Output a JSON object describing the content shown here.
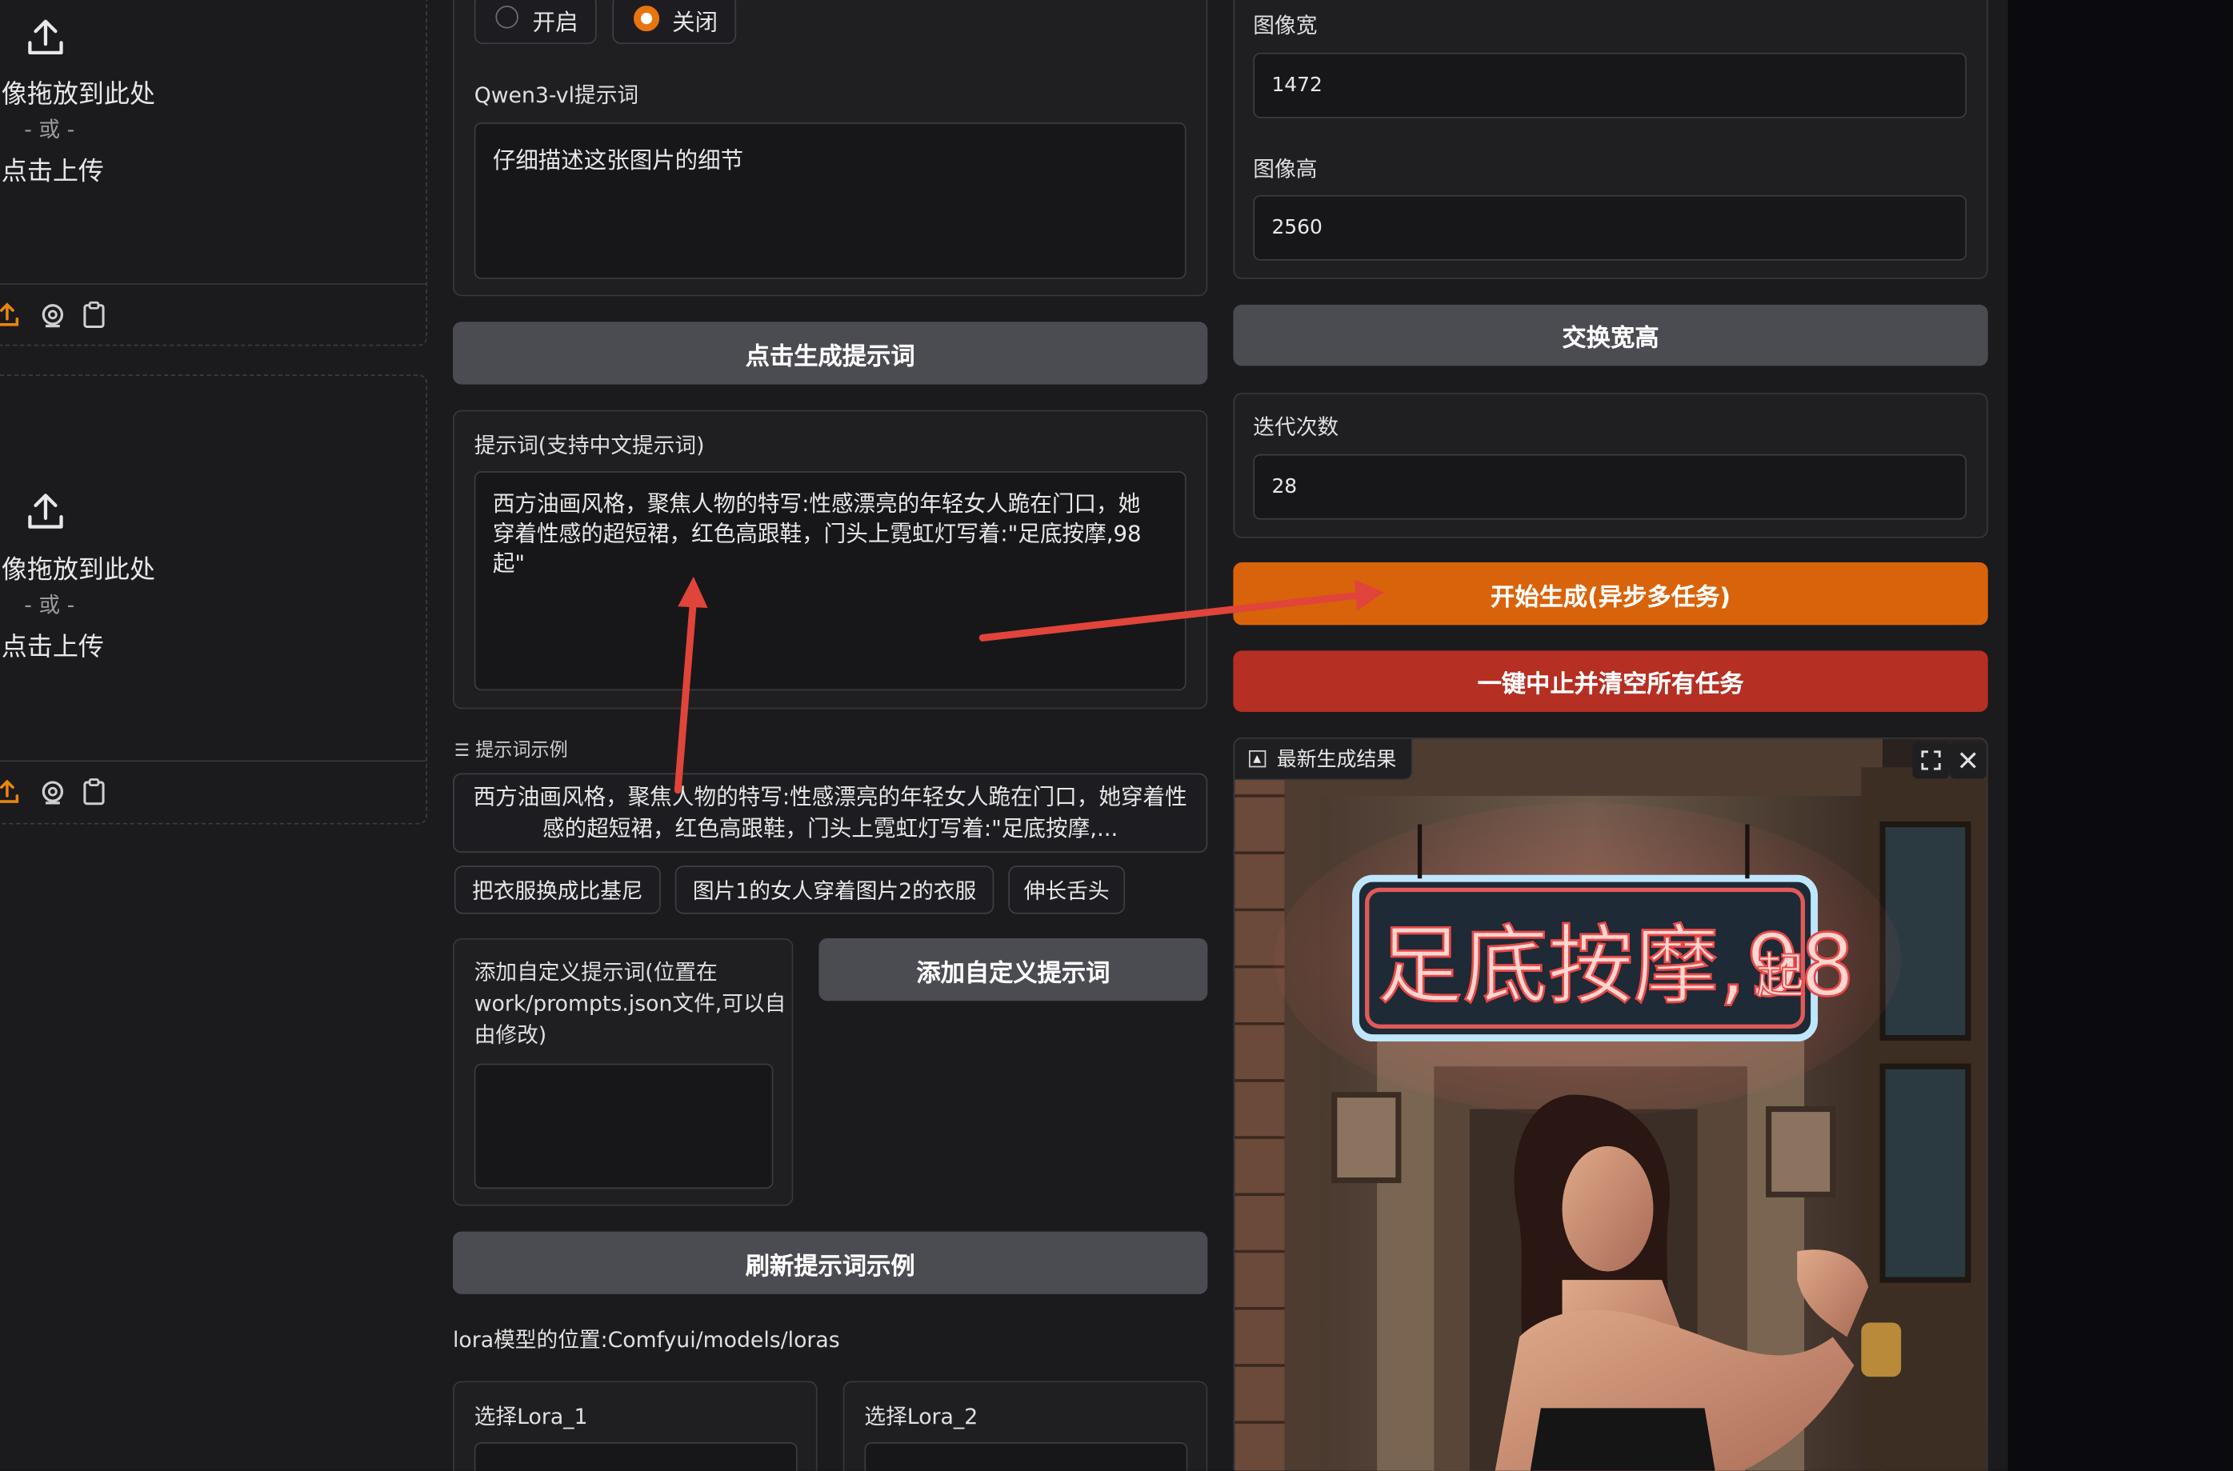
{
  "left_upload": {
    "drop_text": "像拖放到此处",
    "or_text": "- 或 -",
    "click_text": "点击上传"
  },
  "qwen_toggle": {
    "on_label": "开启",
    "off_label": "关闭",
    "selected": "关闭"
  },
  "qwen_prompt": {
    "label": "Qwen3-vl提示词",
    "value": "仔细描述这张图片的细节"
  },
  "generate_prompt_button": "点击生成提示词",
  "prompt": {
    "label": "提示词(支持中文提示词)",
    "line1": "西方油画风格，聚焦人物的特写:性感漂亮的年轻女人跪在门口，她",
    "line2": "穿着性感的超短裙，红色高跟鞋，门头上霓虹灯写着:\"足底按摩,98",
    "line3": "起\""
  },
  "examples": {
    "header": "提示词示例",
    "first_line1": "西方油画风格，聚焦人物的特写:性感漂亮的年轻女人跪在门口，她穿着性",
    "first_line2": "感的超短裙，红色高跟鞋，门头上霓虹灯写着:\"足底按摩,...",
    "chip1": "把衣服换成比基尼",
    "chip2": "图片1的女人穿着图片2的衣服",
    "chip3": "伸长舌头"
  },
  "custom_prompt": {
    "label_line1": "添加自定义提示词(位置在",
    "label_line2": "work/prompts.json文件,可以自",
    "label_line3": "由修改)",
    "value": "",
    "button": "添加自定义提示词"
  },
  "refresh_button": "刷新提示词示例",
  "lora": {
    "location": "lora模型的位置:Comfyui/models/loras",
    "lora1_label": "选择Lora_1",
    "lora2_label": "选择Lora_2"
  },
  "image_width": {
    "label": "图像宽",
    "value": "1472"
  },
  "image_height": {
    "label": "图像高",
    "value": "2560"
  },
  "swap_button": "交换宽高",
  "steps": {
    "label": "迭代次数",
    "value": "28"
  },
  "start_button": "开始生成(异步多任务)",
  "stop_button": "一键中止并清空所有任务",
  "result": {
    "label": "最新生成结果",
    "neon_text": "足底按摩,98",
    "neon_suffix": "起"
  },
  "colors": {
    "orange": "#d9630a",
    "red": "#b52f22",
    "gray_button": "#4b4b52",
    "annotation_arrow": "#e0443a"
  }
}
